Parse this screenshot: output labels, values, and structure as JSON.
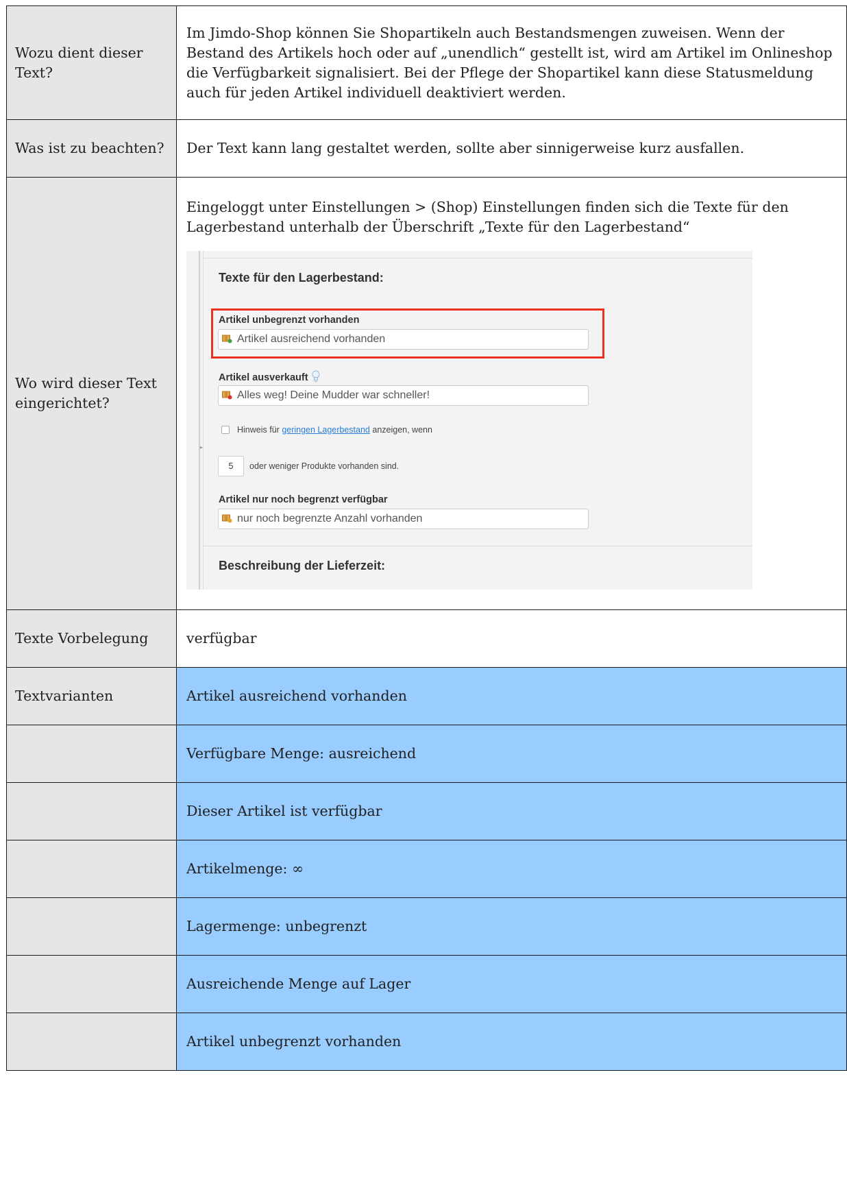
{
  "rows": [
    {
      "label": "Wozu dient dieser Text?",
      "content": "Im Jimdo-Shop können Sie Shopartikeln auch Bestandsmengen zuweisen. Wenn der Bestand des Artikels hoch oder auf „unendlich“ gestellt ist, wird am Artikel im Onlineshop die Verfügbarkeit signalisiert. Bei der Pflege der Shopartikel kann diese Statusmeldung auch für jeden Artikel individuell deaktiviert werden."
    },
    {
      "label": "Was ist zu beachten?",
      "content": "Der Text kann lang gestaltet werden, sollte aber sinnigerweise kurz ausfallen."
    },
    {
      "label": "Wo wird dieser Text eingerichtet?",
      "content": "Eingeloggt unter Einstellungen > (Shop) Einstellungen finden sich die Texte für den Lagerbestand unterhalb der Überschrift „Texte für den Lagerbestand“"
    },
    {
      "label": "Texte Vorbelegung",
      "content": "verfügbar"
    }
  ],
  "settings_screenshot": {
    "section_title": "Texte für den Lagerbestand:",
    "unlimited_label": "Artikel unbegrenzt vorhanden",
    "unlimited_value": "Artikel ausreichend vorhanden",
    "soldout_label": "Artikel ausverkauft",
    "soldout_value": "Alles weg! Deine Mudder war schneller!",
    "low_stock_prefix": "Hinweis für",
    "low_stock_link": "geringen Lagerbestand",
    "low_stock_suffix": "anzeigen, wenn",
    "threshold_value": "5",
    "threshold_text": "oder weniger Produkte vorhanden sind.",
    "limited_label": "Artikel nur noch begrenzt verfügbar",
    "limited_value": "nur noch begrenzte Anzahl vorhanden",
    "next_section_title": "Beschreibung der Lieferzeit:"
  },
  "variants_label": "Textvarianten",
  "variants": [
    "Artikel ausreichend vorhanden",
    "Verfügbare Menge: ausreichend",
    "Dieser Artikel ist verfügbar",
    "Artikelmenge: ∞",
    "Lagermenge: unbegrenzt",
    "Ausreichende Menge auf Lager",
    "Artikel unbegrenzt vorhanden"
  ],
  "colors": {
    "label_background": "#e6e6e6",
    "variant_background": "#99ccff",
    "highlight_border": "#e8311f",
    "link": "#2a7fd4"
  }
}
